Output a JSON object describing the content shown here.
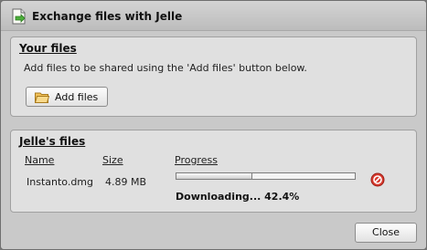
{
  "window": {
    "title": "Exchange files with Jelle",
    "icon": "exchange-file-icon"
  },
  "your_files": {
    "heading": "Your files",
    "description": "Add files to be shared using the 'Add files' button below.",
    "add_button_label": "Add files",
    "add_button_icon": "folder-icon"
  },
  "jelle_files": {
    "heading": "Jelle's files",
    "columns": {
      "name": "Name",
      "size": "Size",
      "progress": "Progress"
    },
    "rows": [
      {
        "name": "Instanto.dmg",
        "size": "4.89 MB",
        "progress_fraction": 0.424,
        "status": "Downloading... 42.4%",
        "cancel_icon": "cancel-icon"
      }
    ]
  },
  "footer": {
    "close_label": "Close"
  },
  "colors": {
    "cancel_red": "#d83a2e",
    "panel_bg": "#e0e0e0",
    "window_bg": "#c9c9c9"
  }
}
